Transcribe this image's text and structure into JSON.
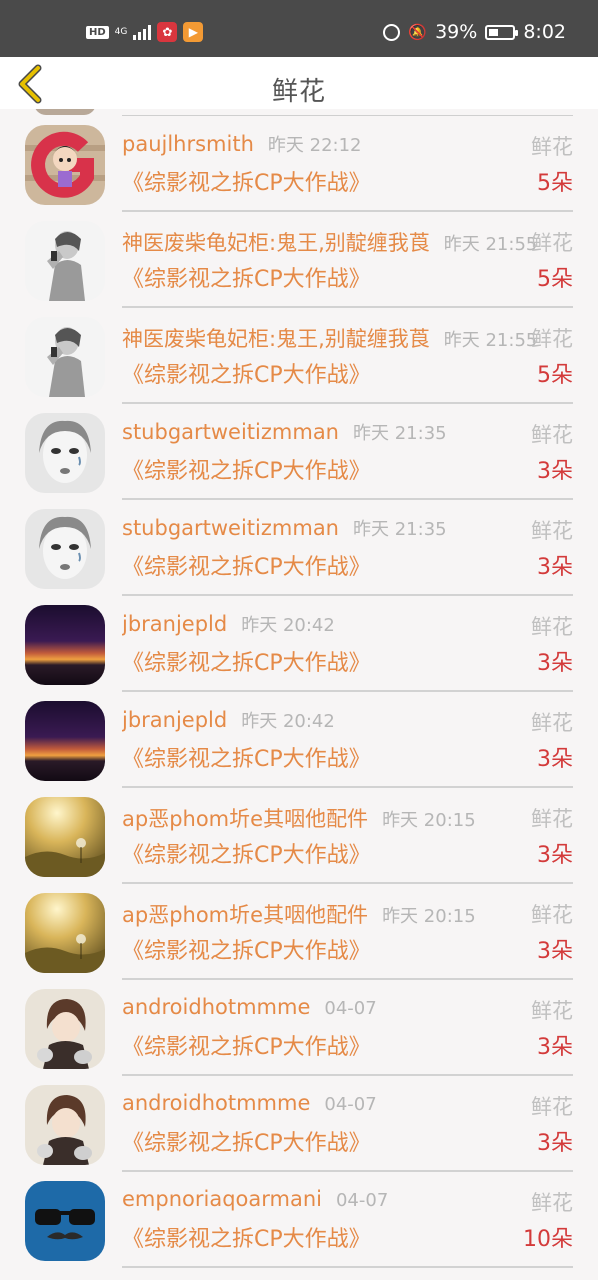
{
  "status_bar": {
    "hd": "HD",
    "network": "4G",
    "battery_percent": "39%",
    "battery_level": 0.39,
    "time": "8:02",
    "icons": [
      "alarm-icon",
      "mute-bell-icon",
      "battery-icon"
    ]
  },
  "header": {
    "title": "鲜花",
    "back_icon": "back-chevron-icon"
  },
  "colors": {
    "name": "#e58a47",
    "amount": "#d33a3a",
    "meta": "#b6b6b6",
    "back_arrow": "#e3b800"
  },
  "items": [
    {
      "name": "paujlhrsmith",
      "time": "昨天 22:12",
      "gift": "鲜花",
      "book": "《综影视之拆CP大作战》",
      "amount": "5朵",
      "avatar": "letter-g-girl-avatar"
    },
    {
      "name": "神医废柴龟妃柜:鬼王,别靛缠我莨",
      "time": "昨天 21:55",
      "gift": "鲜花",
      "book": "《综影视之拆CP大作战》",
      "amount": "5朵",
      "avatar": "sketch-singer-avatar"
    },
    {
      "name": "神医废柴龟妃柜:鬼王,别靛缠我莨",
      "time": "昨天 21:55",
      "gift": "鲜花",
      "book": "《综影视之拆CP大作战》",
      "amount": "5朵",
      "avatar": "sketch-singer-avatar"
    },
    {
      "name": "stubgartweitizmman",
      "time": "昨天 21:35",
      "gift": "鲜花",
      "book": "《综影视之拆CP大作战》",
      "amount": "3朵",
      "avatar": "crying-girl-sketch-avatar"
    },
    {
      "name": "stubgartweitizmman",
      "time": "昨天 21:35",
      "gift": "鲜花",
      "book": "《综影视之拆CP大作战》",
      "amount": "3朵",
      "avatar": "crying-girl-sketch-avatar"
    },
    {
      "name": "jbranjepld",
      "time": "昨天 20:42",
      "gift": "鲜花",
      "book": "《综影视之拆CP大作战》",
      "amount": "3朵",
      "avatar": "sunset-avatar"
    },
    {
      "name": "jbranjepld",
      "time": "昨天 20:42",
      "gift": "鲜花",
      "book": "《综影视之拆CP大作战》",
      "amount": "3朵",
      "avatar": "sunset-avatar"
    },
    {
      "name": "ap恶phom圻e其咽他配件",
      "time": "昨天 20:15",
      "gift": "鲜花",
      "book": "《综影视之拆CP大作战》",
      "amount": "3朵",
      "avatar": "dandelion-field-avatar"
    },
    {
      "name": "ap恶phom圻e其咽他配件",
      "time": "昨天 20:15",
      "gift": "鲜花",
      "book": "《综影视之拆CP大作战》",
      "amount": "3朵",
      "avatar": "dandelion-field-avatar"
    },
    {
      "name": "androidhotmmme",
      "time": "04-07",
      "gift": "鲜花",
      "book": "《综影视之拆CP大作战》",
      "amount": "3朵",
      "avatar": "anime-boy-cat-avatar"
    },
    {
      "name": "androidhotmmme",
      "time": "04-07",
      "gift": "鲜花",
      "book": "《综影视之拆CP大作战》",
      "amount": "3朵",
      "avatar": "anime-boy-cat-avatar"
    },
    {
      "name": "empnoriaqoarmani",
      "time": "04-07",
      "gift": "鲜花",
      "book": "《综影视之拆CP大作战》",
      "amount": "10朵",
      "avatar": "sunglasses-mustache-avatar"
    }
  ]
}
